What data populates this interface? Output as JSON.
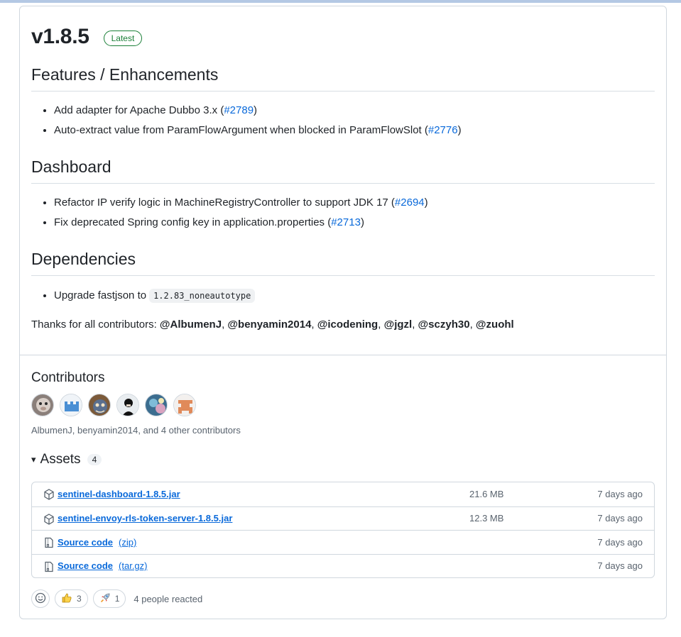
{
  "release": {
    "title": "v1.8.5",
    "badge": "Latest"
  },
  "sections": [
    {
      "heading": "Features / Enhancements",
      "items": [
        {
          "text": "Add adapter for Apache Dubbo 3.x (",
          "link": "#2789",
          "tail": ")"
        },
        {
          "text": "Auto-extract value from ParamFlowArgument when blocked in ParamFlowSlot (",
          "link": "#2776",
          "tail": ")"
        }
      ]
    },
    {
      "heading": "Dashboard",
      "items": [
        {
          "text": "Refactor IP verify logic in MachineRegistryController to support JDK 17 (",
          "link": "#2694",
          "tail": ")"
        },
        {
          "text": "Fix deprecated Spring config key in application.properties (",
          "link": "#2713",
          "tail": ")"
        }
      ]
    },
    {
      "heading": "Dependencies",
      "items": [
        {
          "text": "Upgrade fastjson to",
          "code": "1.2.83_noneautotype"
        }
      ]
    }
  ],
  "thanks": {
    "prefix": "Thanks for all contributors: ",
    "names": [
      "@AlbumenJ",
      "@benyamin2014",
      "@icodening",
      "@jgzl",
      "@sczyh30",
      "@zuohl"
    ],
    "sep": ", "
  },
  "contributors": {
    "title": "Contributors",
    "summary": "AlbumenJ, benyamin2014, and 4 other contributors",
    "avatars": [
      "AlbumenJ",
      "benyamin2014",
      "icodening",
      "jgzl",
      "sczyh30",
      "zuohl"
    ]
  },
  "assets": {
    "caret": "▾",
    "title": "Assets",
    "count": "4",
    "rows": [
      {
        "name": "sentinel-dashboard-1.8.5.jar",
        "format": "",
        "size": "21.6 MB",
        "date": "7 days ago",
        "icon": "package-icon"
      },
      {
        "name": "sentinel-envoy-rls-token-server-1.8.5.jar",
        "format": "",
        "size": "12.3 MB",
        "date": "7 days ago",
        "icon": "package-icon"
      },
      {
        "name": "Source code",
        "format": "(zip)",
        "size": "",
        "date": "7 days ago",
        "icon": "file-zip-icon"
      },
      {
        "name": "Source code",
        "format": "(tar.gz)",
        "size": "",
        "date": "7 days ago",
        "icon": "file-zip-icon"
      }
    ]
  },
  "reactions": {
    "thumbs_up_count": "3",
    "rocket_count": "1",
    "summary": "4 people reacted"
  },
  "colors": {
    "link": "#0969da",
    "latest_badge": "#1a7f37",
    "border": "#d0d7de",
    "muted_text": "#59636e"
  }
}
